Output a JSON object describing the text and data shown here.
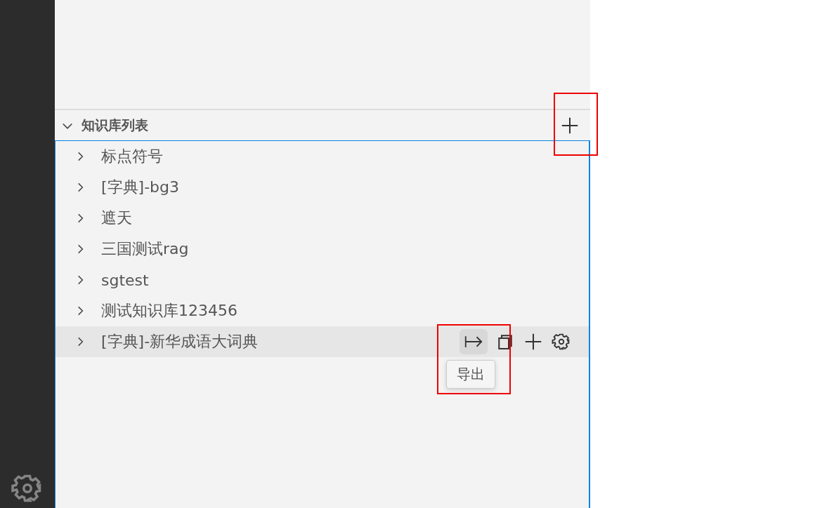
{
  "section": {
    "title": "知识库列表",
    "expanded": true
  },
  "items": [
    {
      "label": "标点符号",
      "hovered": false
    },
    {
      "label": "[字典]-bg3",
      "hovered": false
    },
    {
      "label": "遮天",
      "hovered": false
    },
    {
      "label": "三国测试rag",
      "hovered": false
    },
    {
      "label": "sgtest",
      "hovered": false
    },
    {
      "label": "测试知识库123456",
      "hovered": false
    },
    {
      "label": "[字典]-新华成语大词典",
      "hovered": true
    }
  ],
  "row_actions": [
    {
      "kind": "export",
      "tooltip": "导出"
    },
    {
      "kind": "copy"
    },
    {
      "kind": "add"
    },
    {
      "kind": "settings"
    }
  ]
}
